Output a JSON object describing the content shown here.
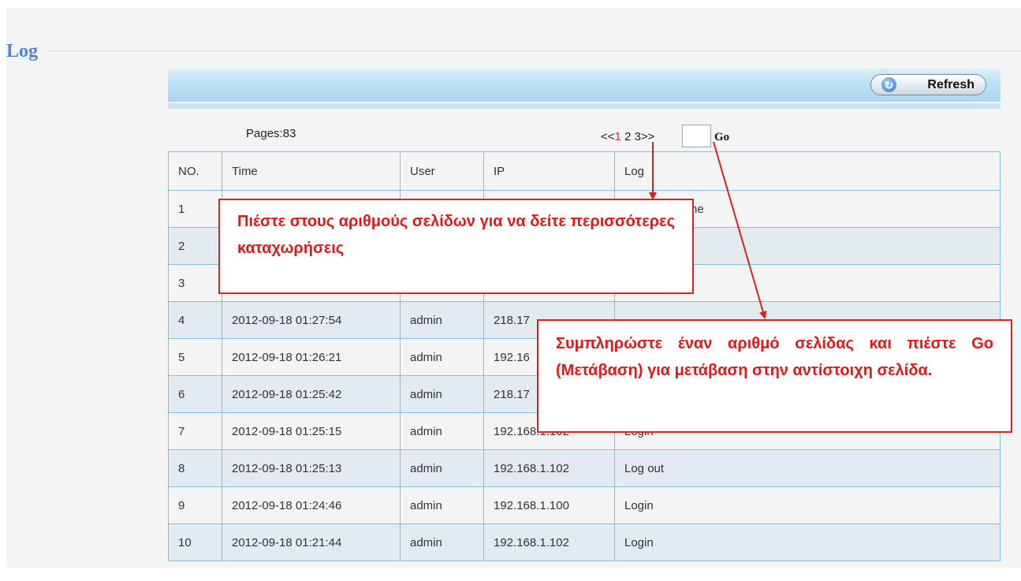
{
  "page": {
    "title": "Log"
  },
  "toolbar": {
    "refresh_label": "Refresh"
  },
  "pagination": {
    "pages_label": "Pages:83",
    "prev": "<<",
    "pages": [
      "1",
      "2",
      "3"
    ],
    "next": ">>",
    "current_page": "1",
    "input_value": "",
    "go_label": "Go"
  },
  "table": {
    "headers": [
      "NO.",
      "Time",
      "User",
      "IP",
      "Log"
    ],
    "rows": [
      {
        "no": "1",
        "time": "",
        "user": "",
        "ip": "",
        "log": "he"
      },
      {
        "no": "2",
        "time": "",
        "user": "",
        "ip": "",
        "log": ""
      },
      {
        "no": "3",
        "time": "",
        "user": "",
        "ip": "",
        "log": ""
      },
      {
        "no": "4",
        "time": "2012-09-18 01:27:54",
        "user": "admin",
        "ip": "218.17",
        "log": ""
      },
      {
        "no": "5",
        "time": "2012-09-18 01:26:21",
        "user": "admin",
        "ip": "192.16",
        "log": ""
      },
      {
        "no": "6",
        "time": "2012-09-18 01:25:42",
        "user": "admin",
        "ip": "218.17",
        "log": ""
      },
      {
        "no": "7",
        "time": "2012-09-18 01:25:15",
        "user": "admin",
        "ip": "192.168.1.102",
        "log": "Login"
      },
      {
        "no": "8",
        "time": "2012-09-18 01:25:13",
        "user": "admin",
        "ip": "192.168.1.102",
        "log": "Log out"
      },
      {
        "no": "9",
        "time": "2012-09-18 01:24:46",
        "user": "admin",
        "ip": "192.168.1.100",
        "log": "Login"
      },
      {
        "no": "10",
        "time": "2012-09-18 01:21:44",
        "user": "admin",
        "ip": "192.168.1.102",
        "log": "Login"
      }
    ]
  },
  "annotations": {
    "page_numbers_note": "Πιέστε στους αριθμούς σελίδων για να δείτε περισσότερες καταχωρήσεις",
    "go_note": "Συμπληρώστε έναν αριθμό σελίδας και πιέστε Go (Μετάβαση) για μετάβαση στην αντίστοιχη σελίδα."
  },
  "colors": {
    "accent_title": "#4f88c9",
    "annotation_red": "#e02020",
    "grid_border": "#7fc1df"
  }
}
